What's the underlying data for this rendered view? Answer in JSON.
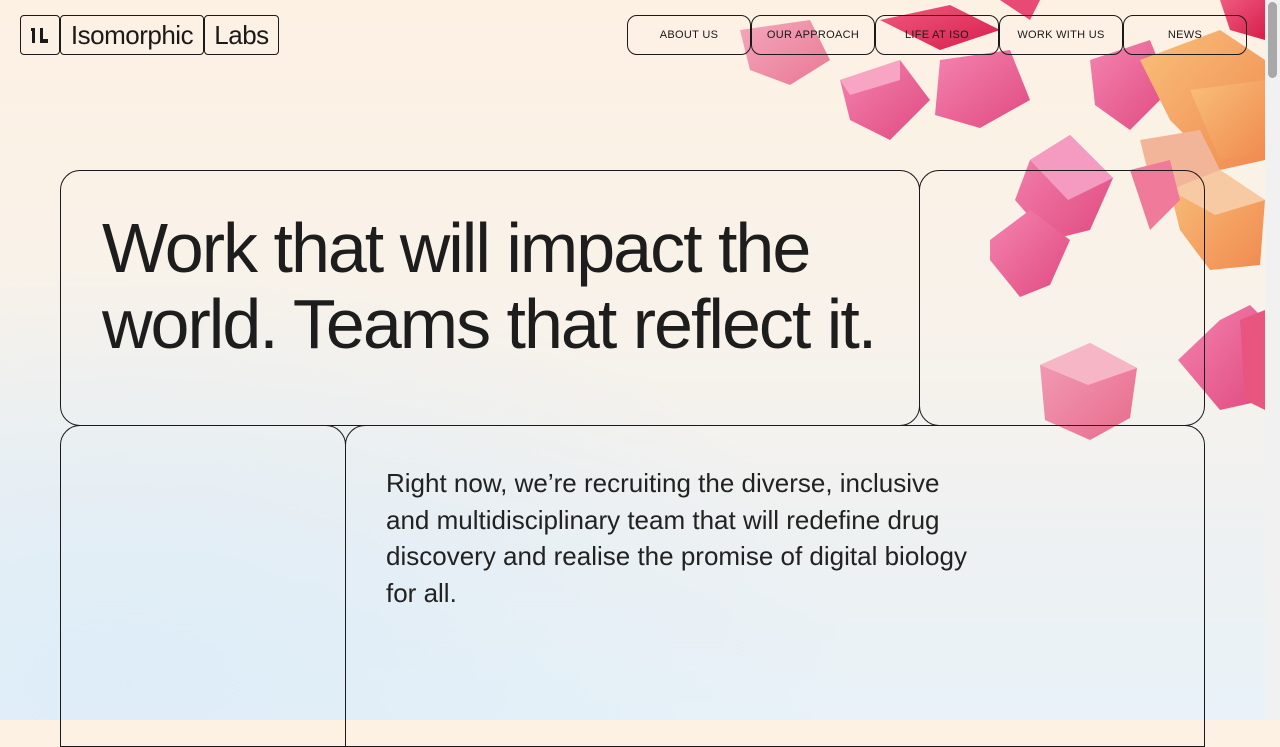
{
  "logo": {
    "mark": "ıl",
    "word1": "Isomorphic",
    "word2": "Labs"
  },
  "nav": {
    "items": [
      {
        "label": "ABOUT US"
      },
      {
        "label": "OUR APPROACH"
      },
      {
        "label": "LIFE AT ISO"
      },
      {
        "label": "WORK WITH US"
      },
      {
        "label": "NEWS"
      }
    ]
  },
  "hero": {
    "headline": "Work that will impact the world. Teams that reflect it."
  },
  "body": {
    "text": "Right now, we’re recruiting the diverse, inclusive and multidisciplinary team that will redefine drug discovery and realise the promise of digital biology for all."
  },
  "colors": {
    "pink": "#ea5a8f",
    "orange": "#f0a060",
    "background": "#fdf1e3",
    "ink": "#1a1a1a"
  }
}
